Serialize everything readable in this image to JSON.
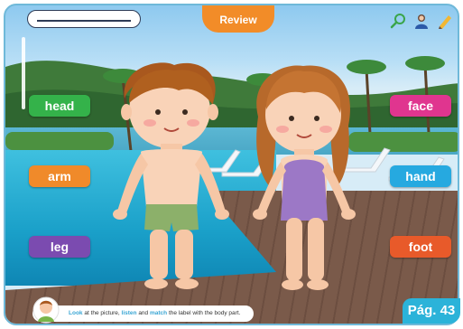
{
  "header": {
    "title": "",
    "review_tab": "Review"
  },
  "tools": [
    {
      "name": "magnifier-icon"
    },
    {
      "name": "user-icon"
    },
    {
      "name": "pencil-icon"
    }
  ],
  "labels": {
    "head": "head",
    "arm": "arm",
    "leg": "leg",
    "face": "face",
    "hand": "hand",
    "foot": "foot"
  },
  "instruction": {
    "w1": "Look",
    "t1": " at the picture, ",
    "w2": "listen",
    "t2": " and ",
    "w3": "match",
    "t3": " the label with the body part."
  },
  "page": "Pág. 43",
  "colors": {
    "green": "#34b24a",
    "orange": "#f08a2a",
    "purple": "#7b4bb0",
    "pink": "#e0358f",
    "blue": "#26a9e0",
    "red_orange": "#e85a2a",
    "review": "#f28c28",
    "badge": "#2bb3d9"
  }
}
